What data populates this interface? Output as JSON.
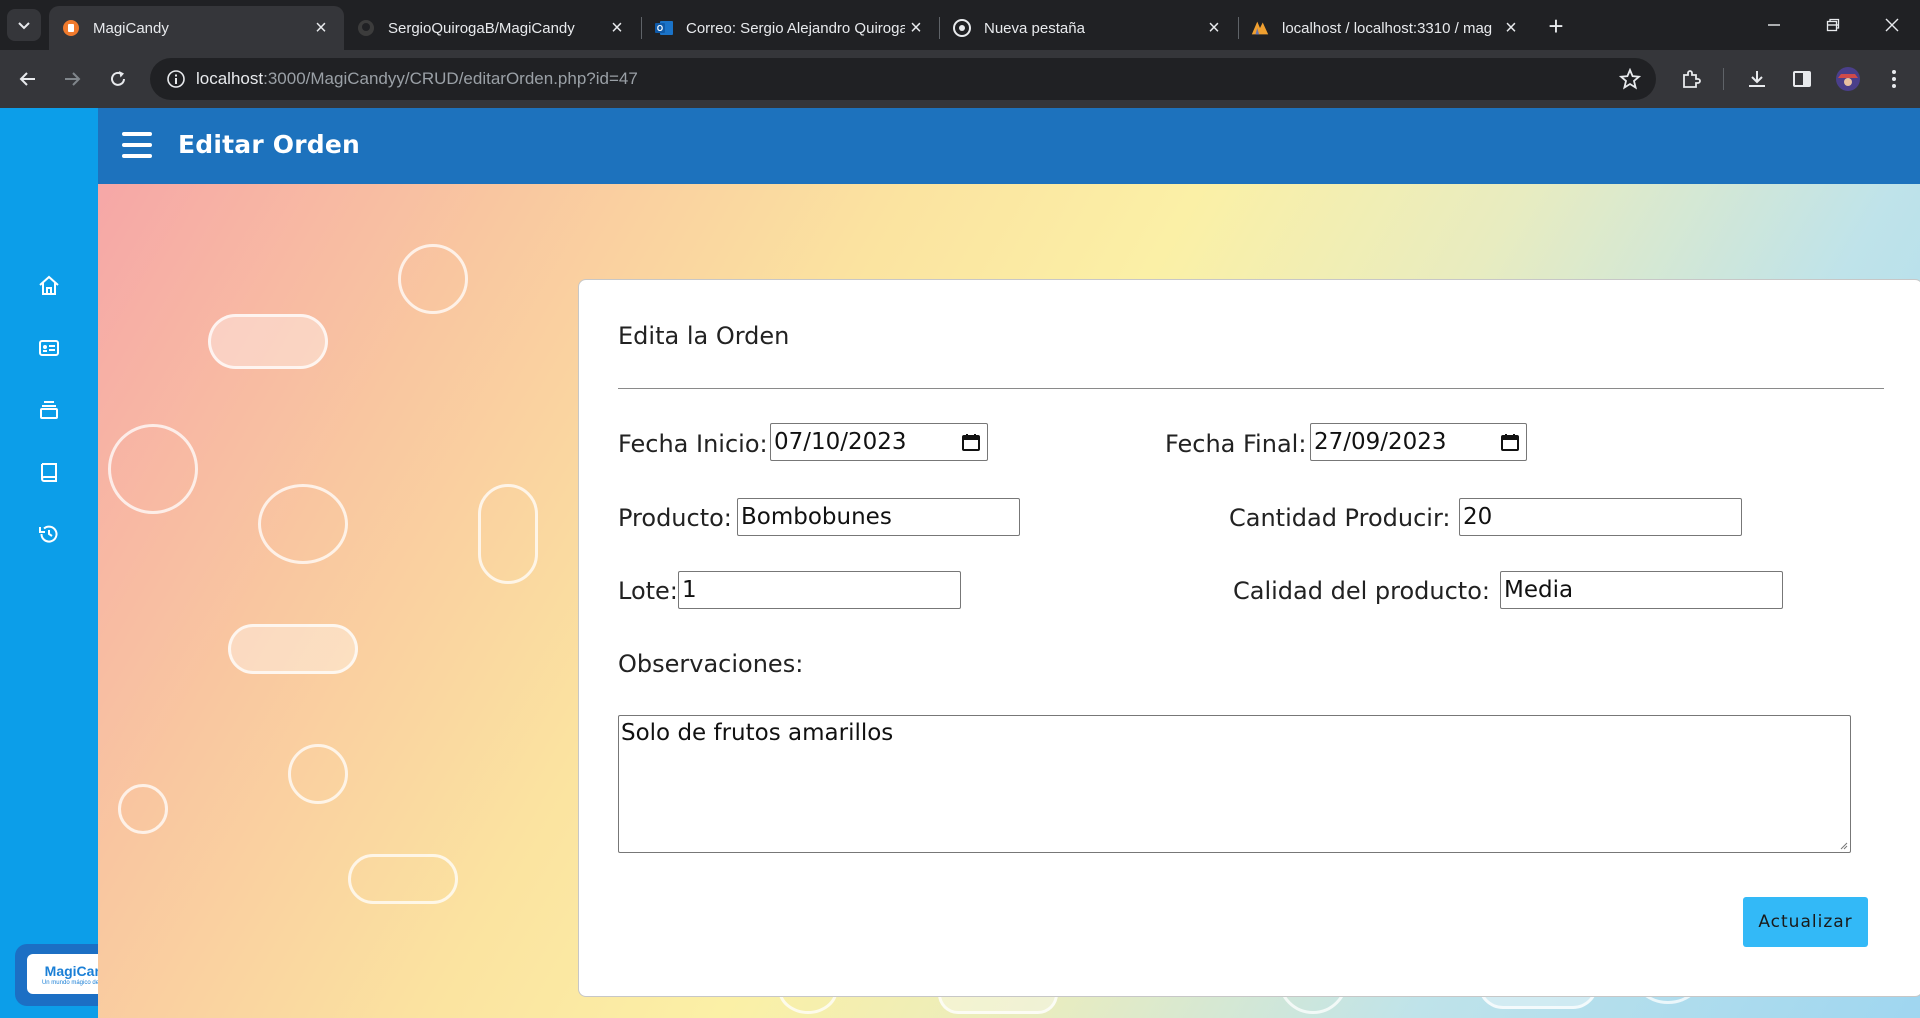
{
  "browser": {
    "tabs": [
      {
        "title": "MagiCandy",
        "icon": "app-orange-icon",
        "active": true
      },
      {
        "title": "SergioQuirogaB/MagiCandy",
        "icon": "github-icon",
        "active": false
      },
      {
        "title": "Correo: Sergio Alejandro Quiroga",
        "icon": "outlook-icon",
        "active": false
      },
      {
        "title": "Nueva pestaña",
        "icon": "chrome-icon",
        "active": false
      },
      {
        "title": "localhost / localhost:3310 / mag",
        "icon": "phpmyadmin-icon",
        "active": false
      }
    ],
    "url_host": "localhost",
    "url_rest": ":3000/MagiCandyy/CRUD/editarOrden.php?id=47"
  },
  "app": {
    "title": "Editar Orden",
    "sidebar": [
      {
        "icon": "home-icon"
      },
      {
        "icon": "id-card-icon"
      },
      {
        "icon": "stack-icon"
      },
      {
        "icon": "book-icon"
      },
      {
        "icon": "history-icon"
      }
    ],
    "brand": {
      "name": "MagiCandy",
      "tagline": "Un mundo mágico de sabores"
    }
  },
  "form": {
    "heading": "Edita la Orden",
    "fecha_inicio_label": "Fecha Inicio:",
    "fecha_inicio_value": "07/10/2023",
    "fecha_final_label": "Fecha Final:",
    "fecha_final_value": "27/09/2023",
    "producto_label": "Producto:",
    "producto_value": "Bombobunes",
    "cantidad_label": "Cantidad Producir:",
    "cantidad_value": "20",
    "lote_label": "Lote:",
    "lote_value": "1",
    "calidad_label": "Calidad del producto:",
    "calidad_value": "Media",
    "observaciones_label": "Observaciones:",
    "observaciones_value": "Solo de frutos amarillos",
    "submit_label": "Actualizar"
  },
  "colors": {
    "sidebar": "#0c9ee9",
    "appbar": "#1d72bd",
    "button": "#33b9f7"
  }
}
